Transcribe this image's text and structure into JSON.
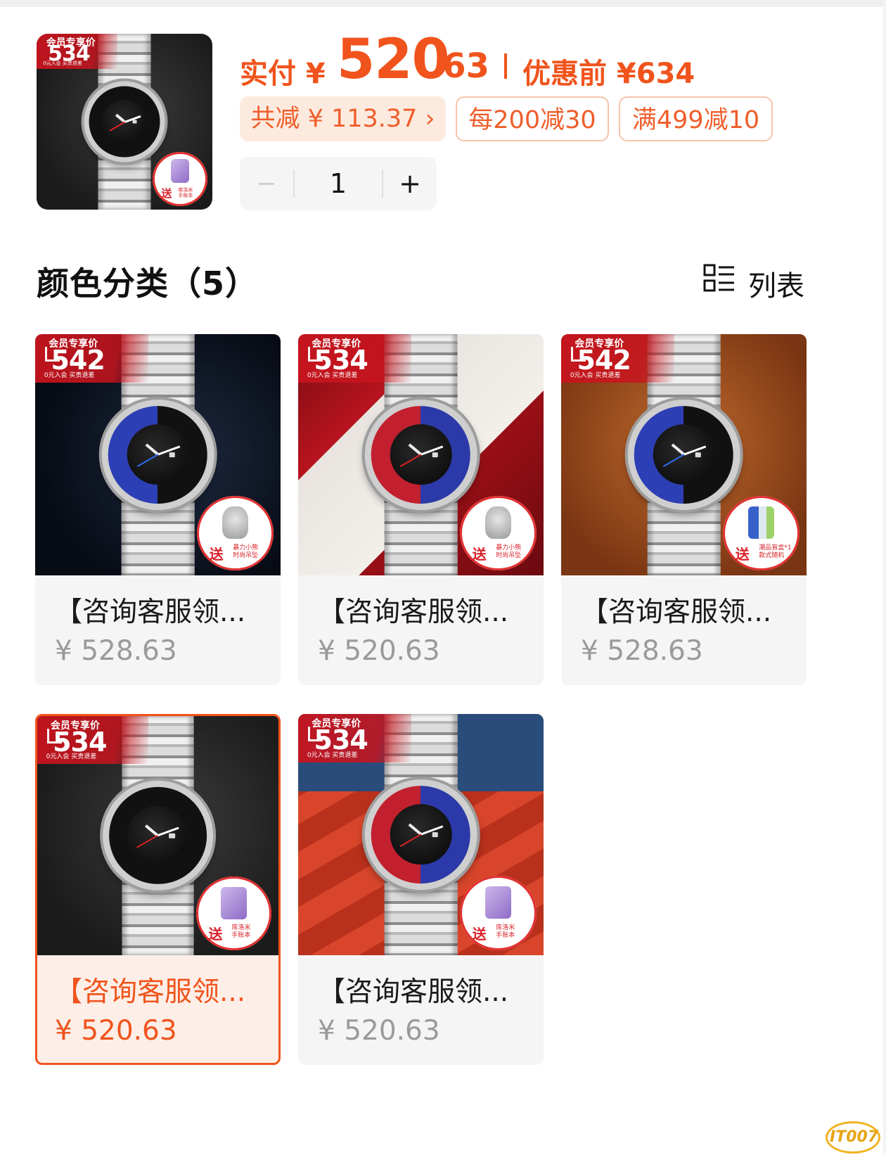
{
  "header": {
    "thumb_promo": {
      "title": "会员专享价",
      "price": "534",
      "sub": "0元入会 买贵退差",
      "gift_prefix": "送",
      "gift_text": "库洛米\n手账本"
    },
    "pay_label": "实付 ¥",
    "pay_int": "520",
    "pay_dec": ".63",
    "before_label": "优惠前 ¥634"
  },
  "discounts": {
    "total": "共减 ¥ 113.37 ›",
    "coupon1": "每200减30",
    "coupon2": "满499减10"
  },
  "stepper": {
    "minus": "−",
    "value": "1",
    "plus": "+"
  },
  "section": {
    "title": "颜色分类（5）",
    "view_toggle": "列表"
  },
  "products": [
    {
      "name": "【咨询客服领...",
      "price": "¥ 528.63",
      "promo_title": "会员专享价",
      "promo_price": "542",
      "promo_sub": "0元入会 买贵退差",
      "gift_prefix": "送",
      "gift_text": "暴力小熊\n时尚吊坠"
    },
    {
      "name": "【咨询客服领...",
      "price": "¥ 520.63",
      "promo_title": "会员专享价",
      "promo_price": "534",
      "promo_sub": "0元入会 买贵退差",
      "gift_prefix": "送",
      "gift_text": "暴力小熊\n时尚吊坠"
    },
    {
      "name": "【咨询客服领...",
      "price": "¥ 528.63",
      "promo_title": "会员专享价",
      "promo_price": "542",
      "promo_sub": "0元入会 买贵退差",
      "gift_prefix": "送",
      "gift_text": "潮品盲盒*1\n款式随机"
    },
    {
      "name": "【咨询客服领...",
      "price": "¥ 520.63",
      "promo_title": "会员专享价",
      "promo_price": "534",
      "promo_sub": "0元入会 买贵退差",
      "gift_prefix": "送",
      "gift_text": "库洛米\n手账本"
    },
    {
      "name": "【咨询客服领...",
      "price": "¥ 520.63",
      "promo_title": "会员专享价",
      "promo_price": "534",
      "promo_sub": "0元入会 买贵退差",
      "gift_prefix": "送",
      "gift_text": "库洛米\n手账本"
    }
  ],
  "watermark": "IT007",
  "colors": {
    "accent": "#f0541c",
    "chip_bg": "#fdeadf",
    "chip_border": "#f6c3aa",
    "card_bg": "#f5f5f5",
    "price_gray": "#9a9a9a"
  },
  "icons": [
    "expand-icon",
    "list-view-icon",
    "watch-image",
    "gift-badge"
  ]
}
